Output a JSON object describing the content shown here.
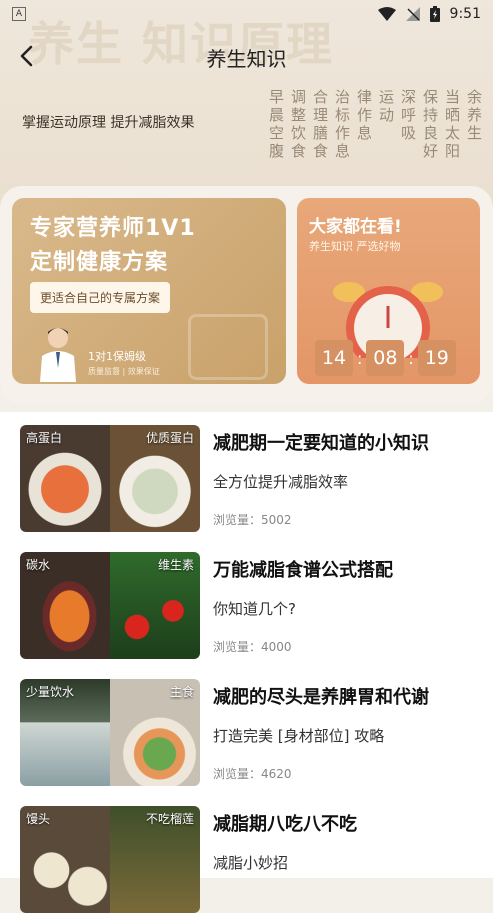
{
  "status": {
    "time": "9:51",
    "left_icon_letter": "A"
  },
  "nav": {
    "title": "养生知识",
    "back_icon": "back-arrow-icon"
  },
  "hero": {
    "bg_text": "养生 知识原理",
    "subtitle": "掌握运动原理 提升减脂效果",
    "calligraphy": [
      "早晨空腹",
      "调整饮食",
      "合理膳食",
      "治标作息",
      "律作息",
      "运动",
      "深呼吸",
      "保持良好",
      "当晒太阳",
      "余养生"
    ]
  },
  "promo": {
    "expert": {
      "title_line1": "专家营养师1V1",
      "title_line2": "定制健康方案",
      "button": "更适合自己的专属方案",
      "caption": "1对1保姆级",
      "small": "质量监督 | 效果保证"
    },
    "timer": {
      "title": "大家都在看!",
      "subtitle": "养生知识 严选好物",
      "hours": "14",
      "minutes": "08",
      "seconds": "19"
    }
  },
  "articles": [
    {
      "title": "减肥期一定要知道的小知识",
      "desc": "全方位提升减脂效率",
      "views": "浏览量：5002",
      "tag_left": "高蛋白",
      "tag_right": "优质蛋白"
    },
    {
      "title": "万能减脂食谱公式搭配",
      "desc": "你知道几个?",
      "views": "浏览量：4000",
      "tag_left": "碳水",
      "tag_right": "维生素"
    },
    {
      "title": "减肥的尽头是养脾胃和代谢",
      "desc": "打造完美 [身材部位] 攻略",
      "views": "浏览量：4620",
      "tag_left": "少量饮水",
      "tag_right": "主食"
    },
    {
      "title": "减脂期八吃八不吃",
      "desc": "减脂小妙招",
      "views": "",
      "tag_left": "馒头",
      "tag_right": "不吃榴莲"
    }
  ],
  "colors": {
    "accent_gold": "#c9a16a",
    "accent_orange": "#e49667"
  }
}
